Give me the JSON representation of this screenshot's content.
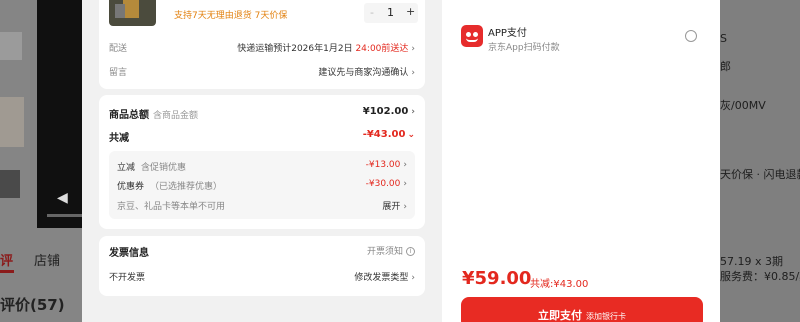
{
  "background": {
    "tab_reviews": "评",
    "tab_store": "店铺",
    "reviews_heading": "评价(57)",
    "right_fragments": [
      "S",
      "郎",
      "灰/00MV",
      "天价保 · 闪电退款",
      "57.19 x 3期",
      "服务费：¥0.85/期"
    ]
  },
  "item": {
    "guarantee": "支持7天无理由退货   7天价保",
    "qty_minus": "-",
    "quantity": "1",
    "qty_plus": "+"
  },
  "delivery": {
    "label": "配送",
    "value_prefix": "快递运输预计2026年1月2日",
    "value_highlight": "24:00前送达"
  },
  "message": {
    "label": "留言",
    "value": "建议先与商家沟通确认"
  },
  "summary": {
    "goods_total_label": "商品总额",
    "goods_total_sub": "含商品金额",
    "goods_total_value": "¥102.00",
    "discount_total_label": "共减",
    "discount_total_value": "-¥43.00",
    "instant_label": "立减",
    "instant_sub": "含促销优惠",
    "instant_value": "-¥13.00",
    "coupon_label": "优惠券",
    "coupon_sub": "（已选推荐优惠）",
    "coupon_value": "-¥30.00",
    "unavailable_note": "京豆、礼品卡等本单不可用",
    "expand_label": "展开"
  },
  "invoice": {
    "title": "发票信息",
    "notice": "开票须知",
    "current": "不开发票",
    "modify": "修改发票类型"
  },
  "payment": {
    "method_title": "APP支付",
    "method_sub": "京东App扫码付款",
    "total": "¥59.00",
    "saved": "共减:¥43.00",
    "pay_button": "立即支付",
    "pay_button_extra": "添加银行卡"
  },
  "colors": {
    "accent": "#e3281e",
    "guarantee": "#e2800e"
  }
}
